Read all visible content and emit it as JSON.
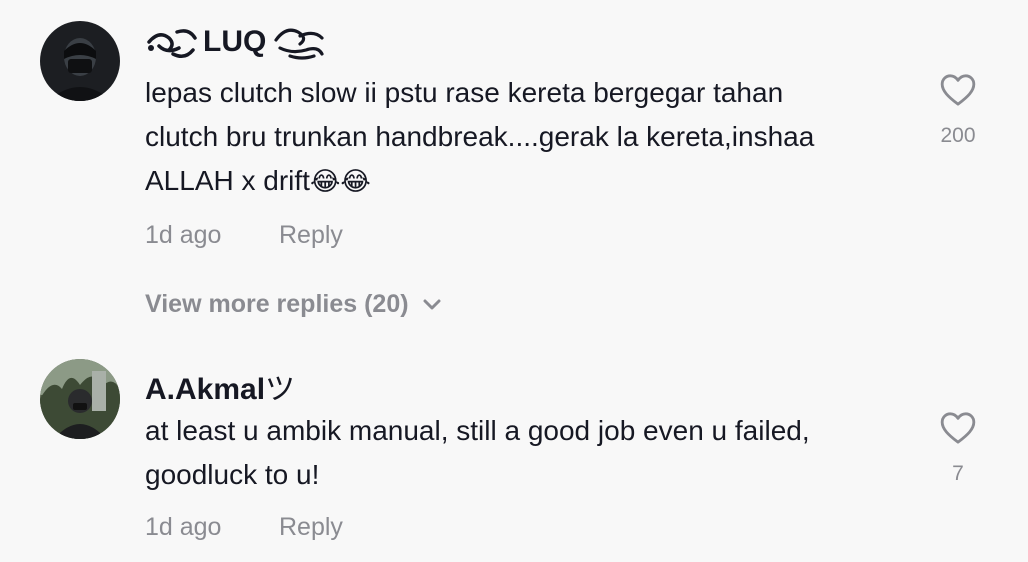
{
  "comments": [
    {
      "username": "LUQ",
      "text_line1": "lepas clutch slow ii pstu rase kereta bergegar tahan",
      "text_line2": "clutch bru trunkan handbreak....gerak la kereta,inshaa",
      "text_line3": "ALLAH x drift",
      "emoji": "😂😂",
      "time": "1d ago",
      "reply_label": "Reply",
      "like_count": "200",
      "like_icon": "heart-outline-icon"
    },
    {
      "username": "A.Akmal",
      "username_suffix": "ツ",
      "text_line1": "at least u ambik manual, still a good job even u failed,",
      "text_line2": "goodluck to u!",
      "time": "1d ago",
      "reply_label": "Reply",
      "like_count": "7",
      "like_icon": "heart-outline-icon"
    }
  ],
  "view_more": {
    "label": "View more replies (20)",
    "icon": "chevron-down-icon"
  },
  "colors": {
    "background": "#f8f8f8",
    "text": "#161823",
    "muted": "#8a8b91"
  }
}
